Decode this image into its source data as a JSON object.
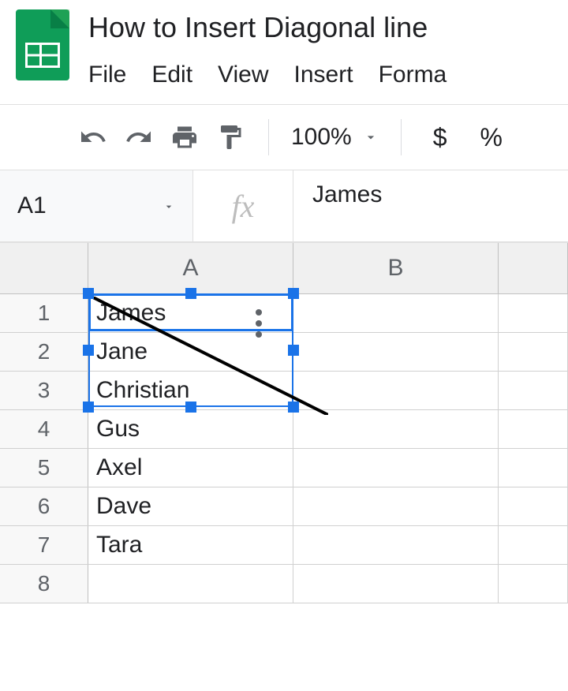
{
  "doc_title": "How to Insert Diagonal line",
  "menu": {
    "file": "File",
    "edit": "Edit",
    "view": "View",
    "insert": "Insert",
    "format": "Forma"
  },
  "toolbar": {
    "zoom": "100%",
    "currency": "$",
    "percent": "%"
  },
  "formula_bar": {
    "cell_ref": "A1",
    "fx_label": "fx",
    "value": "James"
  },
  "columns": [
    "A",
    "B"
  ],
  "rows": [
    {
      "num": "1",
      "a": "James",
      "b": ""
    },
    {
      "num": "2",
      "a": "Jane",
      "b": ""
    },
    {
      "num": "3",
      "a": "Christian",
      "b": ""
    },
    {
      "num": "4",
      "a": "Gus",
      "b": ""
    },
    {
      "num": "5",
      "a": "Axel",
      "b": ""
    },
    {
      "num": "6",
      "a": "Dave",
      "b": ""
    },
    {
      "num": "7",
      "a": "Tara",
      "b": ""
    },
    {
      "num": "8",
      "a": "",
      "b": ""
    }
  ]
}
